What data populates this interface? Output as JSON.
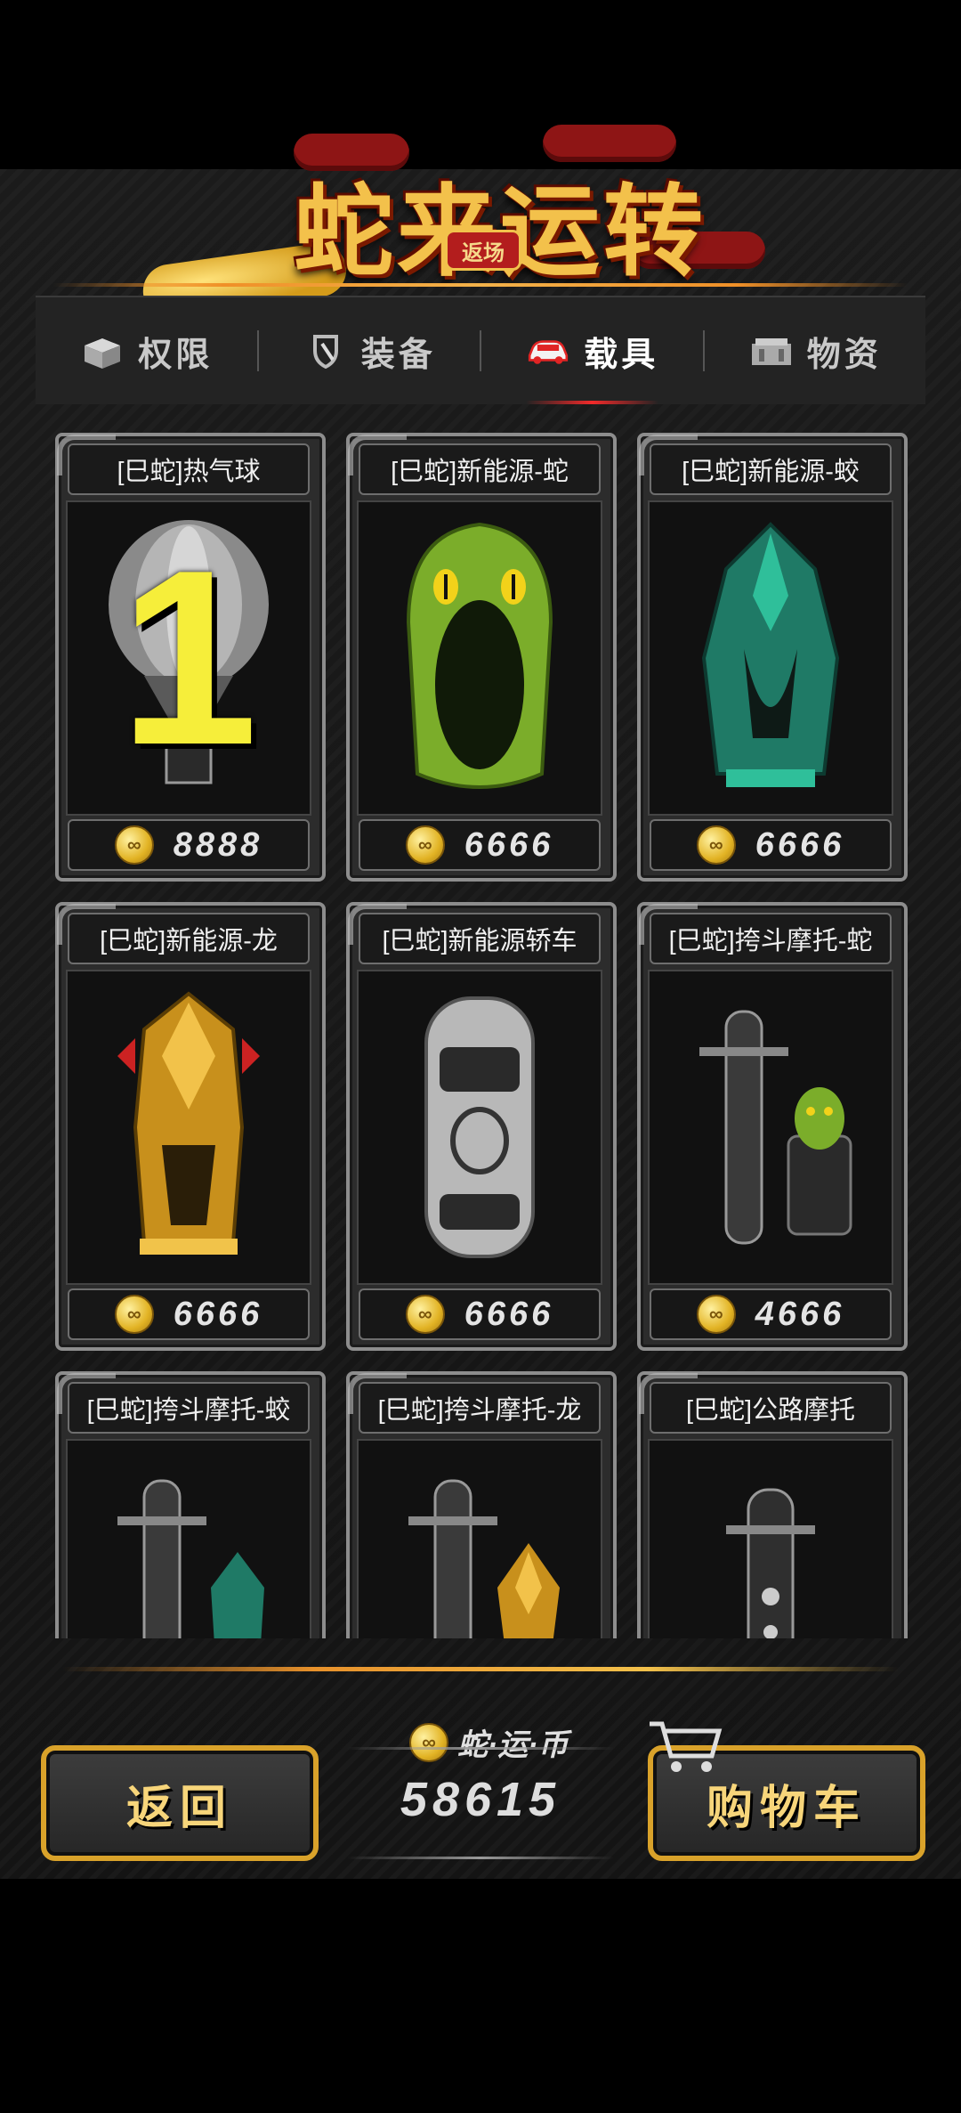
{
  "header": {
    "title": "蛇来运转",
    "badge": "返场"
  },
  "tabs": [
    {
      "label": "权限",
      "icon": "box-icon",
      "active": false
    },
    {
      "label": "装备",
      "icon": "shield-icon",
      "active": false
    },
    {
      "label": "载具",
      "icon": "car-icon",
      "active": true
    },
    {
      "label": "物资",
      "icon": "crate-icon",
      "active": false
    }
  ],
  "items": [
    {
      "name": "[巳蛇]热气球",
      "price": "8888",
      "icon": "hot-air-balloon-icon",
      "overlay": "1"
    },
    {
      "name": "[巳蛇]新能源-蛇",
      "price": "6666",
      "icon": "snake-car-icon"
    },
    {
      "name": "[巳蛇]新能源-蛟",
      "price": "6666",
      "icon": "jiao-car-icon"
    },
    {
      "name": "[巳蛇]新能源-龙",
      "price": "6666",
      "icon": "dragon-car-icon"
    },
    {
      "name": "[巳蛇]新能源轿车",
      "price": "6666",
      "icon": "sedan-icon"
    },
    {
      "name": "[巳蛇]挎斗摩托-蛇",
      "price": "4666",
      "icon": "sidecar-snake-icon"
    },
    {
      "name": "[巳蛇]挎斗摩托-蛟",
      "price": "",
      "icon": "sidecar-jiao-icon"
    },
    {
      "name": "[巳蛇]挎斗摩托-龙",
      "price": "",
      "icon": "sidecar-dragon-icon"
    },
    {
      "name": "[巳蛇]公路摩托",
      "price": "",
      "icon": "road-motorcycle-icon"
    }
  ],
  "footer": {
    "back_label": "返回",
    "cart_label": "购物车",
    "currency_label": "蛇·运·币",
    "currency_value": "58615"
  },
  "colors": {
    "gold": "#f3c14b",
    "active_tab_underline": "#f12a2a",
    "card_border": "#8d8d8d"
  }
}
